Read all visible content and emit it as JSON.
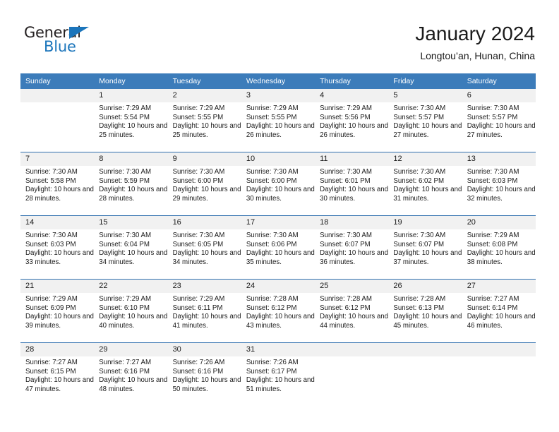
{
  "brand": {
    "name_part1": "General",
    "name_part2": "Blue",
    "triangle_color": "#1b75bb"
  },
  "header": {
    "title": "January 2024",
    "subtitle": "Longtou’an, Hunan, China"
  },
  "theme": {
    "header_blue": "#3c7cba",
    "separator_blue": "#2f6fae",
    "daynum_band": "#f1f1f1",
    "text": "#1a1a1a"
  },
  "weekdays": [
    "Sunday",
    "Monday",
    "Tuesday",
    "Wednesday",
    "Thursday",
    "Friday",
    "Saturday"
  ],
  "weeks": [
    [
      {
        "day": "",
        "sunrise": "",
        "sunset": "",
        "daylight": ""
      },
      {
        "day": "1",
        "sunrise": "Sunrise: 7:29 AM",
        "sunset": "Sunset: 5:54 PM",
        "daylight": "Daylight: 10 hours and 25 minutes."
      },
      {
        "day": "2",
        "sunrise": "Sunrise: 7:29 AM",
        "sunset": "Sunset: 5:55 PM",
        "daylight": "Daylight: 10 hours and 25 minutes."
      },
      {
        "day": "3",
        "sunrise": "Sunrise: 7:29 AM",
        "sunset": "Sunset: 5:55 PM",
        "daylight": "Daylight: 10 hours and 26 minutes."
      },
      {
        "day": "4",
        "sunrise": "Sunrise: 7:29 AM",
        "sunset": "Sunset: 5:56 PM",
        "daylight": "Daylight: 10 hours and 26 minutes."
      },
      {
        "day": "5",
        "sunrise": "Sunrise: 7:30 AM",
        "sunset": "Sunset: 5:57 PM",
        "daylight": "Daylight: 10 hours and 27 minutes."
      },
      {
        "day": "6",
        "sunrise": "Sunrise: 7:30 AM",
        "sunset": "Sunset: 5:57 PM",
        "daylight": "Daylight: 10 hours and 27 minutes."
      }
    ],
    [
      {
        "day": "7",
        "sunrise": "Sunrise: 7:30 AM",
        "sunset": "Sunset: 5:58 PM",
        "daylight": "Daylight: 10 hours and 28 minutes."
      },
      {
        "day": "8",
        "sunrise": "Sunrise: 7:30 AM",
        "sunset": "Sunset: 5:59 PM",
        "daylight": "Daylight: 10 hours and 28 minutes."
      },
      {
        "day": "9",
        "sunrise": "Sunrise: 7:30 AM",
        "sunset": "Sunset: 6:00 PM",
        "daylight": "Daylight: 10 hours and 29 minutes."
      },
      {
        "day": "10",
        "sunrise": "Sunrise: 7:30 AM",
        "sunset": "Sunset: 6:00 PM",
        "daylight": "Daylight: 10 hours and 30 minutes."
      },
      {
        "day": "11",
        "sunrise": "Sunrise: 7:30 AM",
        "sunset": "Sunset: 6:01 PM",
        "daylight": "Daylight: 10 hours and 30 minutes."
      },
      {
        "day": "12",
        "sunrise": "Sunrise: 7:30 AM",
        "sunset": "Sunset: 6:02 PM",
        "daylight": "Daylight: 10 hours and 31 minutes."
      },
      {
        "day": "13",
        "sunrise": "Sunrise: 7:30 AM",
        "sunset": "Sunset: 6:03 PM",
        "daylight": "Daylight: 10 hours and 32 minutes."
      }
    ],
    [
      {
        "day": "14",
        "sunrise": "Sunrise: 7:30 AM",
        "sunset": "Sunset: 6:03 PM",
        "daylight": "Daylight: 10 hours and 33 minutes."
      },
      {
        "day": "15",
        "sunrise": "Sunrise: 7:30 AM",
        "sunset": "Sunset: 6:04 PM",
        "daylight": "Daylight: 10 hours and 34 minutes."
      },
      {
        "day": "16",
        "sunrise": "Sunrise: 7:30 AM",
        "sunset": "Sunset: 6:05 PM",
        "daylight": "Daylight: 10 hours and 34 minutes."
      },
      {
        "day": "17",
        "sunrise": "Sunrise: 7:30 AM",
        "sunset": "Sunset: 6:06 PM",
        "daylight": "Daylight: 10 hours and 35 minutes."
      },
      {
        "day": "18",
        "sunrise": "Sunrise: 7:30 AM",
        "sunset": "Sunset: 6:07 PM",
        "daylight": "Daylight: 10 hours and 36 minutes."
      },
      {
        "day": "19",
        "sunrise": "Sunrise: 7:30 AM",
        "sunset": "Sunset: 6:07 PM",
        "daylight": "Daylight: 10 hours and 37 minutes."
      },
      {
        "day": "20",
        "sunrise": "Sunrise: 7:29 AM",
        "sunset": "Sunset: 6:08 PM",
        "daylight": "Daylight: 10 hours and 38 minutes."
      }
    ],
    [
      {
        "day": "21",
        "sunrise": "Sunrise: 7:29 AM",
        "sunset": "Sunset: 6:09 PM",
        "daylight": "Daylight: 10 hours and 39 minutes."
      },
      {
        "day": "22",
        "sunrise": "Sunrise: 7:29 AM",
        "sunset": "Sunset: 6:10 PM",
        "daylight": "Daylight: 10 hours and 40 minutes."
      },
      {
        "day": "23",
        "sunrise": "Sunrise: 7:29 AM",
        "sunset": "Sunset: 6:11 PM",
        "daylight": "Daylight: 10 hours and 41 minutes."
      },
      {
        "day": "24",
        "sunrise": "Sunrise: 7:28 AM",
        "sunset": "Sunset: 6:12 PM",
        "daylight": "Daylight: 10 hours and 43 minutes."
      },
      {
        "day": "25",
        "sunrise": "Sunrise: 7:28 AM",
        "sunset": "Sunset: 6:12 PM",
        "daylight": "Daylight: 10 hours and 44 minutes."
      },
      {
        "day": "26",
        "sunrise": "Sunrise: 7:28 AM",
        "sunset": "Sunset: 6:13 PM",
        "daylight": "Daylight: 10 hours and 45 minutes."
      },
      {
        "day": "27",
        "sunrise": "Sunrise: 7:27 AM",
        "sunset": "Sunset: 6:14 PM",
        "daylight": "Daylight: 10 hours and 46 minutes."
      }
    ],
    [
      {
        "day": "28",
        "sunrise": "Sunrise: 7:27 AM",
        "sunset": "Sunset: 6:15 PM",
        "daylight": "Daylight: 10 hours and 47 minutes."
      },
      {
        "day": "29",
        "sunrise": "Sunrise: 7:27 AM",
        "sunset": "Sunset: 6:16 PM",
        "daylight": "Daylight: 10 hours and 48 minutes."
      },
      {
        "day": "30",
        "sunrise": "Sunrise: 7:26 AM",
        "sunset": "Sunset: 6:16 PM",
        "daylight": "Daylight: 10 hours and 50 minutes."
      },
      {
        "day": "31",
        "sunrise": "Sunrise: 7:26 AM",
        "sunset": "Sunset: 6:17 PM",
        "daylight": "Daylight: 10 hours and 51 minutes."
      },
      {
        "day": "",
        "sunrise": "",
        "sunset": "",
        "daylight": ""
      },
      {
        "day": "",
        "sunrise": "",
        "sunset": "",
        "daylight": ""
      },
      {
        "day": "",
        "sunrise": "",
        "sunset": "",
        "daylight": ""
      }
    ]
  ]
}
